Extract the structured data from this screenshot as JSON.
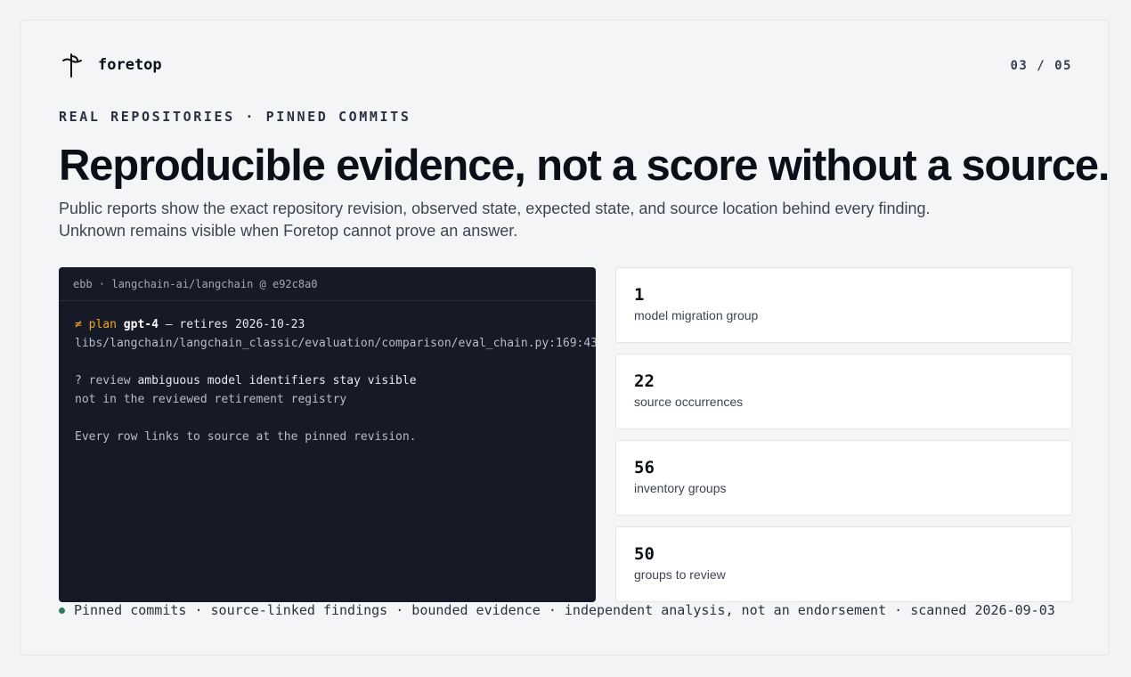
{
  "brand": {
    "name": "foretop",
    "logo_icon": "pin-flag-icon"
  },
  "pager": "03 / 05",
  "eyebrow": "REAL REPOSITORIES · PINNED COMMITS",
  "headline": "Reproducible evidence, not a score without a source.",
  "lede": {
    "line1": "Public reports show the exact repository revision, observed state, expected state, and source location behind every finding.",
    "line2": "Unknown remains visible when Foretop cannot prove an answer."
  },
  "terminal": {
    "header": "ebb · langchain-ai/langchain @ e92c8a0",
    "line1": {
      "prefix": "≠ plan ",
      "model": "gpt-4",
      "suffix": " — retires 2026-10-23"
    },
    "line2": "libs/langchain/langchain_classic/evaluation/comparison/eval_chain.py:169:43",
    "line3": {
      "prefix": "? review ",
      "text": "ambiguous model identifiers stay visible"
    },
    "line4": "not in the reviewed retirement registry",
    "line5": "Every row links to source at the pinned revision."
  },
  "stats": [
    {
      "value": "1",
      "label": "model migration group"
    },
    {
      "value": "22",
      "label": "source occurrences"
    },
    {
      "value": "56",
      "label": "inventory groups"
    },
    {
      "value": "50",
      "label": "groups to review"
    }
  ],
  "footer": {
    "text": "Pinned commits · source-linked findings · bounded evidence · independent analysis, not an endorsement · scanned 2026-09-03",
    "status_color": "#2e7d5b"
  },
  "colors": {
    "accent_orange": "#f5a524",
    "terminal_bg": "#161a26"
  }
}
